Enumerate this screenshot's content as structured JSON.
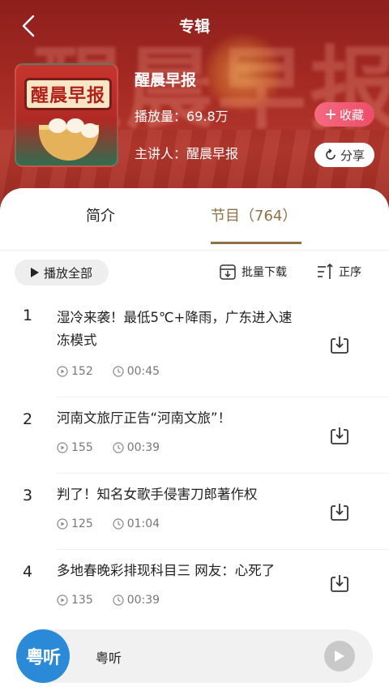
{
  "header": {
    "title": "专辑",
    "back_icon": "chevron-left-icon"
  },
  "album": {
    "name": "醒晨早报",
    "plays_label": "播放量：",
    "plays_value": "69.8万",
    "host_label": "主讲人：",
    "host_name": "醒晨早报",
    "cover_text": "醒晨早报",
    "favorite_label": "收藏",
    "share_label": "分享"
  },
  "tabs": [
    {
      "label": "简介",
      "active": false
    },
    {
      "label": "节目（764）",
      "active": true
    }
  ],
  "toolbar": {
    "play_all": "播放全部",
    "batch_download": "批量下载",
    "order": "正序"
  },
  "episodes": [
    {
      "index": "1",
      "title": "湿冷来袭！最低5℃+降雨，广东进入速冻模式",
      "plays": "152",
      "duration": "00:45"
    },
    {
      "index": "2",
      "title": "河南文旅厅正告“河南文旅”！",
      "plays": "155",
      "duration": "00:39"
    },
    {
      "index": "3",
      "title": "判了！知名女歌手侵害刀郎著作权",
      "plays": "125",
      "duration": "01:04"
    },
    {
      "index": "4",
      "title": "多地春晚彩排现科目三 网友：心死了",
      "plays": "135",
      "duration": "00:39"
    }
  ],
  "player": {
    "logo_text": "粤听",
    "title": "粤听"
  },
  "colors": {
    "hero_red": "#a52a23",
    "accent_brown": "#8f7048",
    "favorite_pink": "#ec4d6a",
    "player_logo_blue": "#2a8ad8"
  }
}
